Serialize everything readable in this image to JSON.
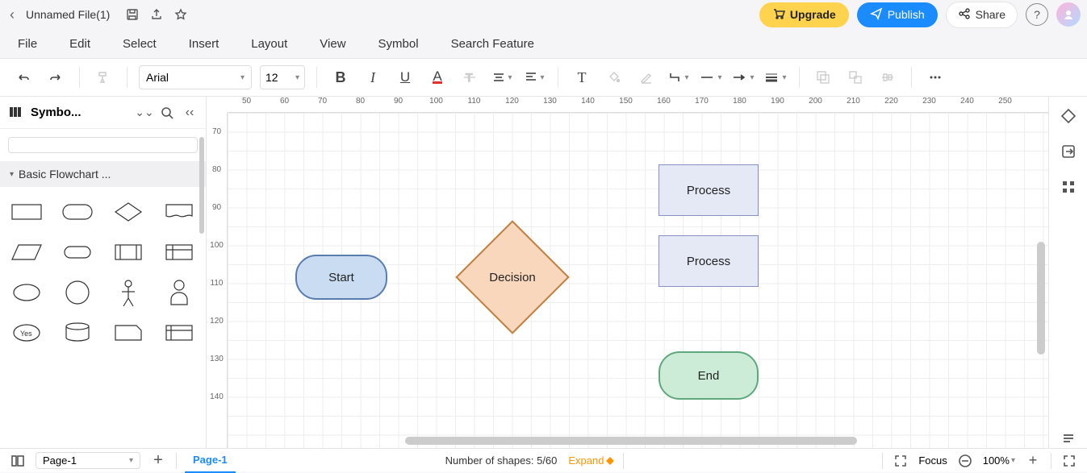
{
  "titlebar": {
    "filename": "Unnamed File(1)",
    "upgrade": "Upgrade",
    "publish": "Publish",
    "share": "Share"
  },
  "menubar": {
    "file": "File",
    "edit": "Edit",
    "select": "Select",
    "insert": "Insert",
    "layout": "Layout",
    "view": "View",
    "symbol": "Symbol",
    "search_feature": "Search Feature"
  },
  "toolbar": {
    "font": "Arial",
    "size": "12"
  },
  "sidebar": {
    "title": "Symbo...",
    "category": "Basic Flowchart ..."
  },
  "ruler_h": [
    "50",
    "60",
    "70",
    "80",
    "90",
    "100",
    "110",
    "120",
    "130",
    "140",
    "150",
    "160",
    "170",
    "180",
    "190",
    "200",
    "210",
    "220",
    "230",
    "240",
    "250"
  ],
  "ruler_v": [
    "70",
    "80",
    "90",
    "100",
    "110",
    "120",
    "130",
    "140"
  ],
  "shapes": {
    "start": "Start",
    "decision": "Decision",
    "process1": "Process",
    "process2": "Process",
    "end": "End"
  },
  "statusbar": {
    "page_dropdown": "Page-1",
    "page_tab": "Page-1",
    "shapes_count": "Number of shapes: 5/60",
    "expand": "Expand",
    "focus": "Focus",
    "zoom": "100%"
  }
}
